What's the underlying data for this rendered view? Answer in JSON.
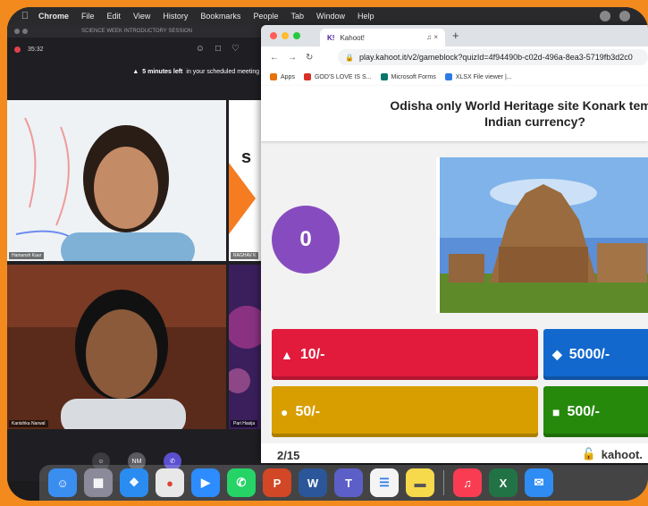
{
  "menubar": {
    "app": "Chrome",
    "items": [
      "File",
      "Edit",
      "View",
      "History",
      "Bookmarks",
      "People",
      "Tab",
      "Window",
      "Help"
    ]
  },
  "meeting": {
    "window_title": "SCIENCE WEEK INTRODUCTORY SESSION",
    "elapsed": "35:32",
    "warning_bold": "5 minutes left",
    "warning_text": "in your scheduled meeting t",
    "participants": [
      {
        "name": "Hamansh Kaur"
      },
      {
        "name": "RAGHAV K"
      },
      {
        "name": "Kanishka Narwal"
      },
      {
        "name": "Pari Hasija"
      }
    ],
    "controls": {
      "initials": "NM"
    }
  },
  "browser": {
    "tab_title": "Kahoot!",
    "tab_favicon": "K!",
    "url": "play.kahoot.it/v2/gameblock?quizId=4f94490b-c02d-496a-8ea3-5719fb3d2c0",
    "bookmarks": [
      {
        "label": "Apps",
        "icon": "apps-grid-icon",
        "color": "#e8710a"
      },
      {
        "label": "GOD'S LOVE IS S...",
        "icon": "youtube-icon",
        "color": "#d93025"
      },
      {
        "label": "Microsoft Forms",
        "icon": "forms-icon",
        "color": "#077568"
      },
      {
        "label": "XLSX File viewer |...",
        "icon": "xlsx-icon",
        "color": "#2d7be5"
      }
    ]
  },
  "kahoot": {
    "question_line1": "Odisha only World Heritage site Konark temple a",
    "question_line2": "Indian currency?",
    "timer": "0",
    "answers": [
      {
        "shape": "▲",
        "label": "10/-",
        "color": "#e21b3c"
      },
      {
        "shape": "◆",
        "label": "5000/-",
        "color": "#1368ce"
      },
      {
        "shape": "●",
        "label": "50/-",
        "color": "#d89e00"
      },
      {
        "shape": "■",
        "label": "500/-",
        "color": "#26890c"
      }
    ],
    "progress": "2/15",
    "brand": "kahoot."
  },
  "dock": {
    "apps": [
      "Finder",
      "Launchpad",
      "Safari",
      "Chrome",
      "Zoom",
      "WhatsApp",
      "PowerPoint",
      "Word",
      "Teams",
      "Reminders",
      "Notes",
      "Music",
      "Excel",
      "Mail"
    ]
  }
}
